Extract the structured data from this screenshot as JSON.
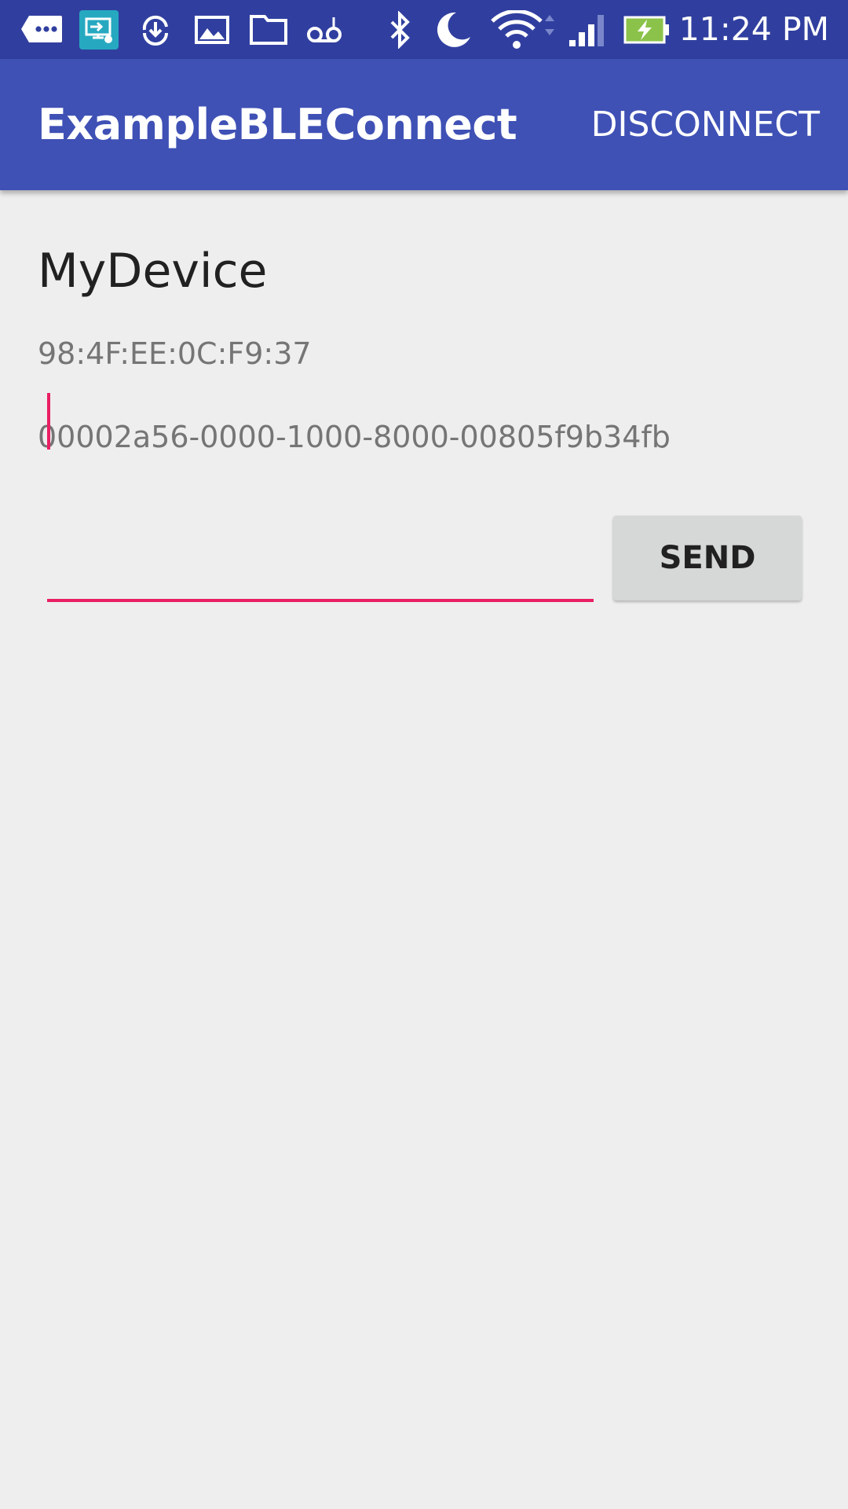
{
  "status_bar": {
    "time": "11:24 PM",
    "icons": [
      "chat-icon",
      "screen-mirror-icon",
      "sync-download-icon",
      "image-icon",
      "folder-icon",
      "voicemail-icon",
      "bluetooth-icon",
      "do-not-disturb-moon-icon",
      "wifi-icon",
      "cell-signal-icon",
      "battery-charging-icon"
    ]
  },
  "app_bar": {
    "title": "ExampleBLEConnect",
    "disconnect_label": "DISCONNECT"
  },
  "device": {
    "name": "MyDevice",
    "address": "98:4F:EE:0C:F9:37",
    "uuid": "00002a56-0000-1000-8000-00805f9b34fb"
  },
  "message": {
    "value": "",
    "send_label": "SEND"
  },
  "colors": {
    "status_bar": "#303f9f",
    "app_bar": "#3f51b5",
    "accent": "#e91e63",
    "background": "#eeeeee"
  }
}
